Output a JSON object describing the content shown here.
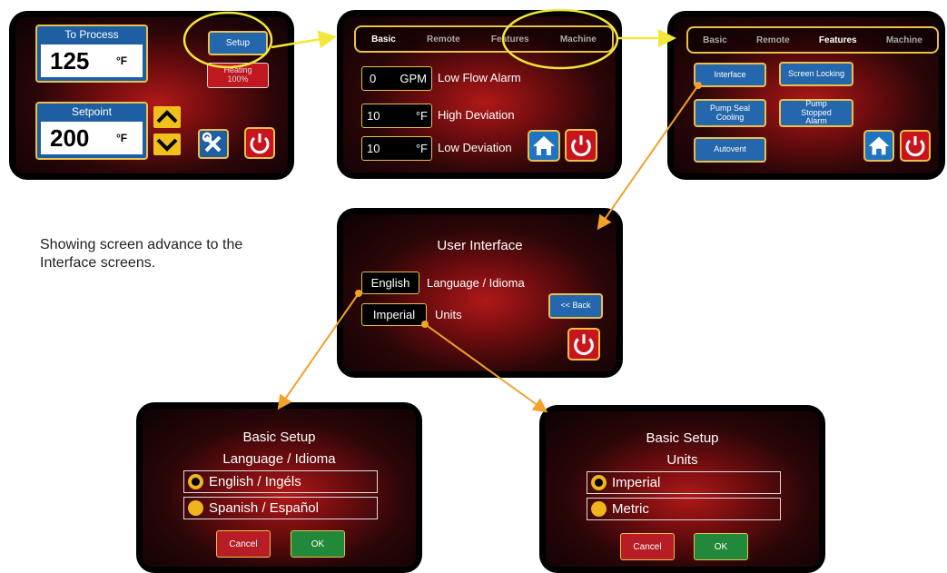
{
  "colors": {
    "accent": "#e9c04a",
    "blue_button": "#2467ad",
    "power_red": "#c8141c",
    "ok_green": "#23893a",
    "connector": "#f0a22a",
    "highlight_ellipse": "#f2e73a"
  },
  "screen1": {
    "to_process_label": "To Process",
    "to_process_value": "125",
    "to_process_unit": "°F",
    "setup_button": "Setup",
    "heating_label": "Heating",
    "heating_percent": "100%",
    "setpoint_label": "Setpoint",
    "setpoint_value": "200",
    "setpoint_unit": "°F",
    "icons": [
      "chevron-up-icon",
      "chevron-down-icon",
      "tools-icon",
      "power-icon"
    ]
  },
  "screen2": {
    "tabs": [
      "Basic",
      "Remote",
      "Features",
      "Machine"
    ],
    "rows": [
      {
        "value": "0",
        "unit": "GPM",
        "label": "Low Flow Alarm"
      },
      {
        "value": "10",
        "unit": "°F",
        "label": "High Deviation"
      },
      {
        "value": "10",
        "unit": "°F",
        "label": "Low Deviation"
      }
    ],
    "icons": [
      "home-icon",
      "power-icon"
    ]
  },
  "screen3": {
    "tabs": [
      "Basic",
      "Remote",
      "Features",
      "Machine"
    ],
    "buttons": {
      "interface": "Interface",
      "screen_locking": "Screen Locking",
      "pump_seal_cooling": "Pump Seal Cooling",
      "pump_stopped_alarm": "Pump Stopped Alarm",
      "autovent": "Autovent"
    },
    "icons": [
      "home-icon",
      "power-icon"
    ]
  },
  "caption": "Showing screen advance to the Interface screens.",
  "screen4": {
    "title": "User Interface",
    "language_button": "English",
    "language_label": "Language / Idioma",
    "units_button": "Imperial",
    "units_label": "Units",
    "back_button": "<< Back",
    "icons": [
      "power-icon"
    ]
  },
  "screen5": {
    "title": "Basic Setup",
    "subtitle": "Language / Idioma",
    "options": [
      "English / Ingéls",
      "Spanish / Español"
    ],
    "selected": "English / Ingéls",
    "cancel": "Cancel",
    "ok": "OK"
  },
  "screen6": {
    "title": "Basic Setup",
    "subtitle": "Units",
    "options": [
      "Imperial",
      "Metric"
    ],
    "selected": "Imperial",
    "cancel": "Cancel",
    "ok": "OK"
  }
}
